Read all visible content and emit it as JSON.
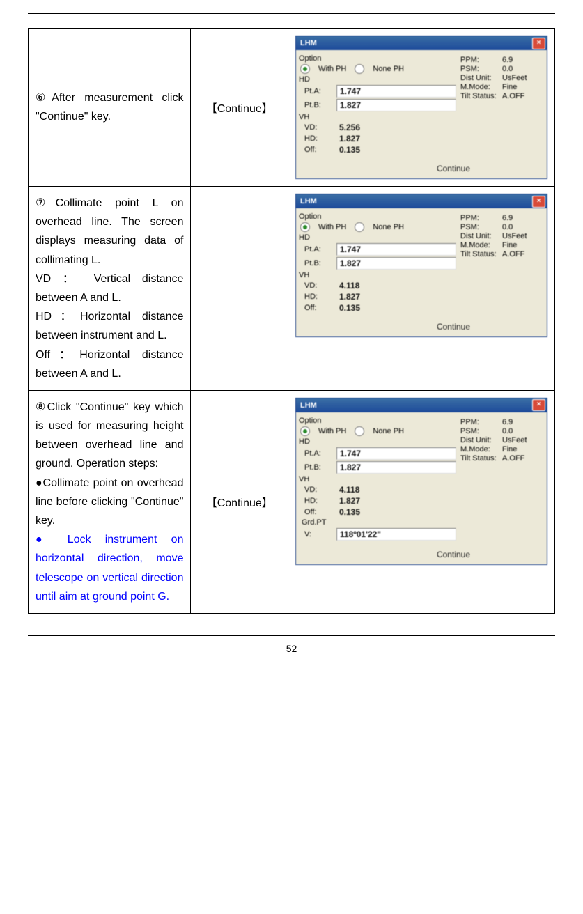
{
  "page_number": "52",
  "rows": [
    {
      "col1_lines": [
        "⑥After measurement click \"Continue\" key."
      ],
      "col2": "【Continue】",
      "dlg": {
        "title": "LHM",
        "radios": {
          "with_ph": "With PH",
          "none_ph": "None PH"
        },
        "section_hd": "HD",
        "pt_a": {
          "label": "Pt.A:",
          "value": "1.747"
        },
        "pt_b": {
          "label": "Pt.B:",
          "value": "1.827"
        },
        "section_vh": "VH",
        "vd": {
          "label": "VD:",
          "value": "5.256"
        },
        "hd": {
          "label": "HD:",
          "value": "1.827"
        },
        "off": {
          "label": "Off:",
          "value": "0.135"
        },
        "grd": null,
        "info": {
          "ppm": {
            "k": "PPM:",
            "v": "6.9"
          },
          "psm": {
            "k": "PSM:",
            "v": "0.0"
          },
          "dist": {
            "k": "Dist Unit:",
            "v": "UsFeet"
          },
          "mmode": {
            "k": "M.Mode:",
            "v": "Fine"
          },
          "tilt": {
            "k": "Tilt Status:",
            "v": "A.OFF"
          }
        },
        "buttons": {
          "continue": "Continue",
          "disabled": ""
        }
      }
    },
    {
      "col1_lines": [
        "⑦Collimate point L on overhead line. The screen displays measuring data of collimating L.",
        "VD ： Vertical distance between A and L.",
        "HD：Horizontal distance between instrument and L.",
        "Off：Horizontal distance between A and L."
      ],
      "col2": "",
      "dlg": {
        "title": "LHM",
        "radios": {
          "with_ph": "With PH",
          "none_ph": "None PH"
        },
        "section_hd": "HD",
        "pt_a": {
          "label": "Pt.A:",
          "value": "1.747"
        },
        "pt_b": {
          "label": "Pt.B:",
          "value": "1.827"
        },
        "section_vh": "VH",
        "vd": {
          "label": "VD:",
          "value": "4.118"
        },
        "hd": {
          "label": "HD:",
          "value": "1.827"
        },
        "off": {
          "label": "Off:",
          "value": "0.135"
        },
        "grd": null,
        "info": {
          "ppm": {
            "k": "PPM:",
            "v": "6.9"
          },
          "psm": {
            "k": "PSM:",
            "v": "0.0"
          },
          "dist": {
            "k": "Dist Unit:",
            "v": "UsFeet"
          },
          "mmode": {
            "k": "M.Mode:",
            "v": "Fine"
          },
          "tilt": {
            "k": "Tilt Status:",
            "v": "A.OFF"
          }
        },
        "buttons": {
          "continue": "Continue",
          "disabled": ""
        }
      }
    },
    {
      "col1_lines": [
        "⑧Click \"Continue\" key which is used for measuring height between overhead line and ground. Operation steps:",
        "●Collimate point on overhead line before clicking \"Continue\" key."
      ],
      "col1_blue": "● Lock instrument on horizontal direction, move telescope on vertical direction until aim at ground point G.",
      "col2": "【Continue】",
      "dlg": {
        "title": "LHM",
        "radios": {
          "with_ph": "With PH",
          "none_ph": "None PH"
        },
        "section_hd": "HD",
        "pt_a": {
          "label": "Pt.A:",
          "value": "1.747"
        },
        "pt_b": {
          "label": "Pt.B:",
          "value": "1.827"
        },
        "section_vh": "VH",
        "vd": {
          "label": "VD:",
          "value": "4.118"
        },
        "hd": {
          "label": "HD:",
          "value": "1.827"
        },
        "off": {
          "label": "Off:",
          "value": "0.135"
        },
        "grd": {
          "label": "Grd.PT",
          "sub": "V:",
          "value": "118º01'22\""
        },
        "info": {
          "ppm": {
            "k": "PPM:",
            "v": "6.9"
          },
          "psm": {
            "k": "PSM:",
            "v": "0.0"
          },
          "dist": {
            "k": "Dist Unit:",
            "v": "UsFeet"
          },
          "mmode": {
            "k": "M.Mode:",
            "v": "Fine"
          },
          "tilt": {
            "k": "Tilt Status:",
            "v": "A.OFF"
          }
        },
        "buttons": {
          "continue": "Continue",
          "disabled": ""
        }
      }
    }
  ]
}
